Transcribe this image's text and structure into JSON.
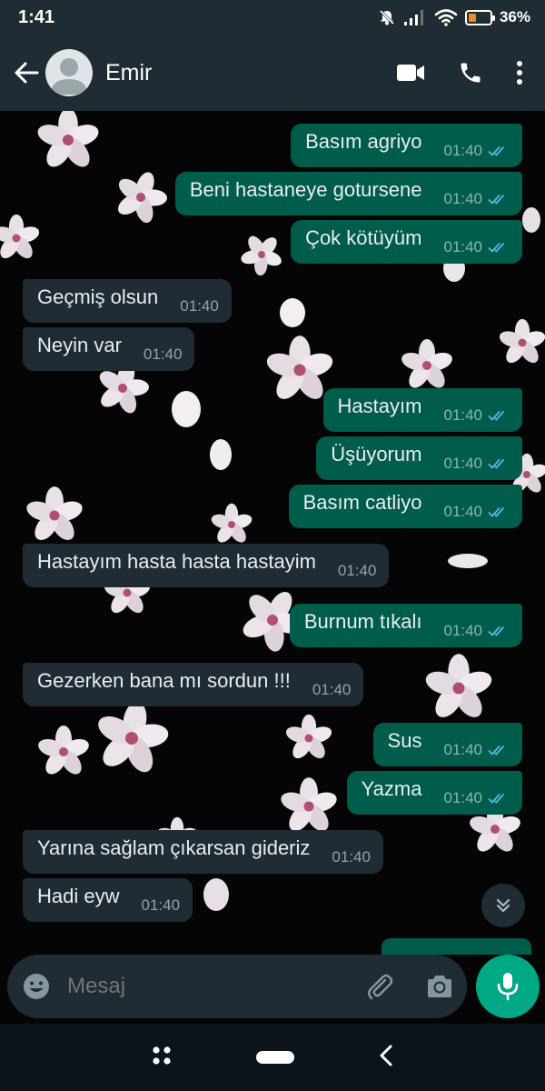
{
  "status_bar": {
    "time": "1:41",
    "battery": "36%",
    "battery_level": 0.36,
    "icons": [
      "mute-icon",
      "signal-icon",
      "wifi-icon",
      "battery-icon"
    ]
  },
  "header": {
    "contact_name": "Emir",
    "icons": [
      "back-arrow-icon",
      "avatar-icon",
      "video-call-icon",
      "voice-call-icon",
      "more-options-icon"
    ]
  },
  "messages": [
    {
      "dir": "out",
      "text": "Basım agriyo",
      "time": "01:40"
    },
    {
      "dir": "out",
      "text": "Beni hastaneye gotursene",
      "time": "01:40"
    },
    {
      "dir": "out",
      "text": "Çok kötüyüm",
      "time": "01:40"
    },
    {
      "dir": "in",
      "text": "Geçmiş olsun",
      "time": "01:40"
    },
    {
      "dir": "in",
      "text": "Neyin var",
      "time": "01:40"
    },
    {
      "dir": "out",
      "text": "Hastayım",
      "time": "01:40"
    },
    {
      "dir": "out",
      "text": "Üşüyorum",
      "time": "01:40"
    },
    {
      "dir": "out",
      "text": "Basım catliyo",
      "time": "01:40"
    },
    {
      "dir": "in",
      "text": "Hastayım hasta hasta hastayim",
      "time": "01:40"
    },
    {
      "dir": "out",
      "text": "Burnum tıkalı",
      "time": "01:40"
    },
    {
      "dir": "in",
      "text": "Gezerken bana mı sordun !!!",
      "time": "01:40"
    },
    {
      "dir": "out",
      "text": "Sus",
      "time": "01:40"
    },
    {
      "dir": "out",
      "text": "Yazma",
      "time": "01:40"
    },
    {
      "dir": "in",
      "text": "Yarına sağlam çıkarsan gideriz",
      "time": "01:40"
    },
    {
      "dir": "in",
      "text": "Hadi eyw",
      "time": "01:40"
    }
  ],
  "input": {
    "placeholder": "Mesaj",
    "icons": [
      "emoji-icon",
      "attach-icon",
      "camera-icon",
      "mic-icon"
    ]
  },
  "colors": {
    "header_bg": "#1f2c34",
    "outgoing_bubble": "#005c4b",
    "incoming_bubble": "#1f2c34",
    "read_ticks": "#53bdeb",
    "accent": "#00a884"
  }
}
